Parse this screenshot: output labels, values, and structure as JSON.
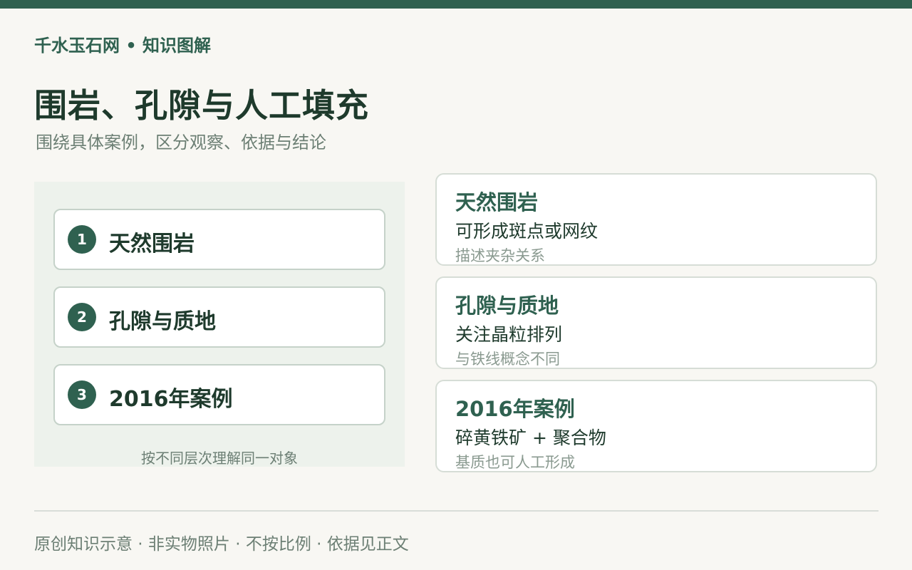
{
  "header": {
    "brand": "千水玉石网 • 知识图解",
    "title": "围岩、孔隙与人工填充",
    "subtitle": "围绕具体案例，区分观察、依据与结论"
  },
  "steps": [
    {
      "num": "1",
      "label": "天然围岩"
    },
    {
      "num": "2",
      "label": "孔隙与质地"
    },
    {
      "num": "3",
      "label": "2016年案例"
    }
  ],
  "left_caption": "按不同层次理解同一对象",
  "cards": [
    {
      "title": "天然围岩",
      "body": "可形成斑点或网纹",
      "note": "描述夹杂关系"
    },
    {
      "title": "孔隙与质地",
      "body": "关注晶粒排列",
      "note": "与铁线概念不同"
    },
    {
      "title": "2016年案例",
      "body": "碎黄铁矿 + 聚合物",
      "note": "基质也可人工形成"
    }
  ],
  "footer": "原创知识示意 · 非实物照片 · 不按比例 · 依据见正文",
  "colors": {
    "accent": "#2f6150",
    "background": "#f8f7f3",
    "panel": "#edf2ec"
  }
}
